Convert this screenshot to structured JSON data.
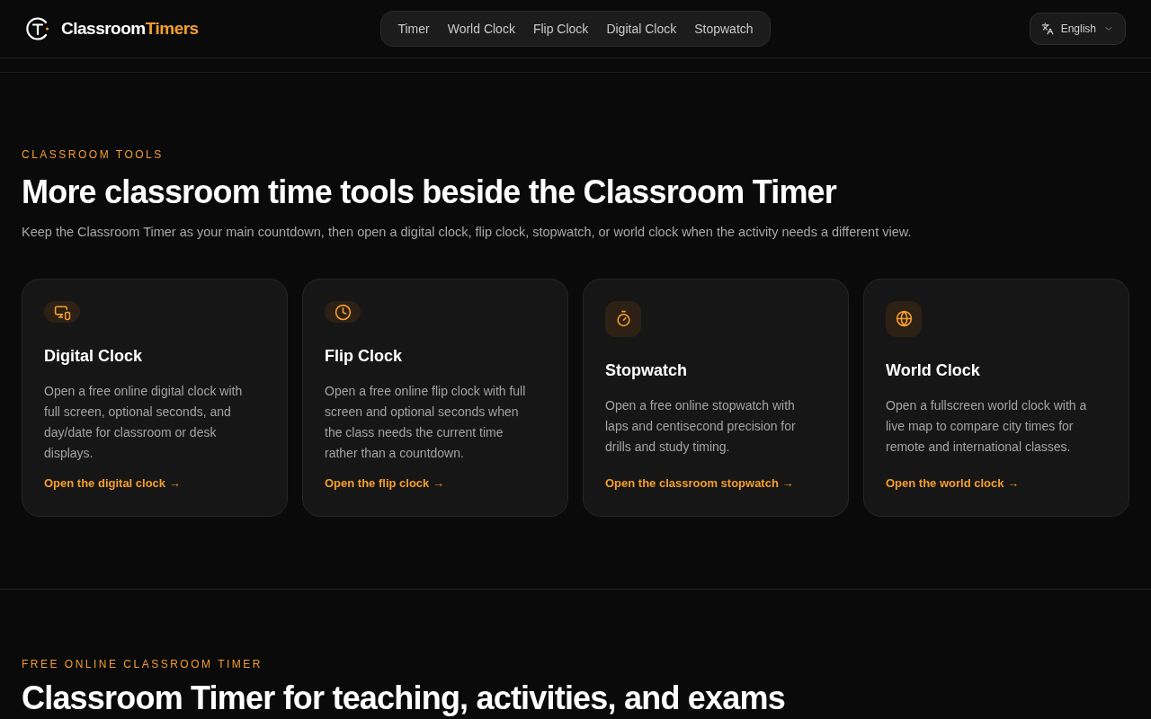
{
  "brand": {
    "name": "Classroom",
    "accent": "Timers"
  },
  "nav": [
    {
      "label": "Timer"
    },
    {
      "label": "World Clock"
    },
    {
      "label": "Flip Clock"
    },
    {
      "label": "Digital Clock"
    },
    {
      "label": "Stopwatch"
    }
  ],
  "language": {
    "label": "English"
  },
  "tools_section": {
    "eyebrow": "CLASSROOM TOOLS",
    "heading": "More classroom time tools beside the Classroom Timer",
    "intro": "Keep the Classroom Timer as your main countdown, then open a digital clock, flip clock, stopwatch, or world clock when the activity needs a different view.",
    "cards": [
      {
        "kind": "digital",
        "title": "Digital Clock",
        "text": "Open a free online digital clock with full screen, optional seconds, and day/date for classroom or desk displays.",
        "link": "Open the digital clock →"
      },
      {
        "kind": "flip",
        "title": "Flip Clock",
        "text": "Open a free online flip clock with full screen and optional seconds when the class needs the current time rather than a countdown.",
        "link": "Open the flip clock →"
      },
      {
        "kind": "stopwatch",
        "title": "Stopwatch",
        "text": "Open a free online stopwatch with laps and centisecond precision for drills and study timing.",
        "link": "Open the classroom stopwatch →"
      },
      {
        "kind": "world",
        "title": "World Clock",
        "text": "Open a fullscreen world clock with a live map to compare city times for remote and international classes.",
        "link": "Open the world clock →"
      }
    ]
  },
  "timer_section": {
    "eyebrow": "FREE ONLINE CLASSROOM TIMER",
    "heading": "Classroom Timer for teaching, activities, and exams"
  }
}
